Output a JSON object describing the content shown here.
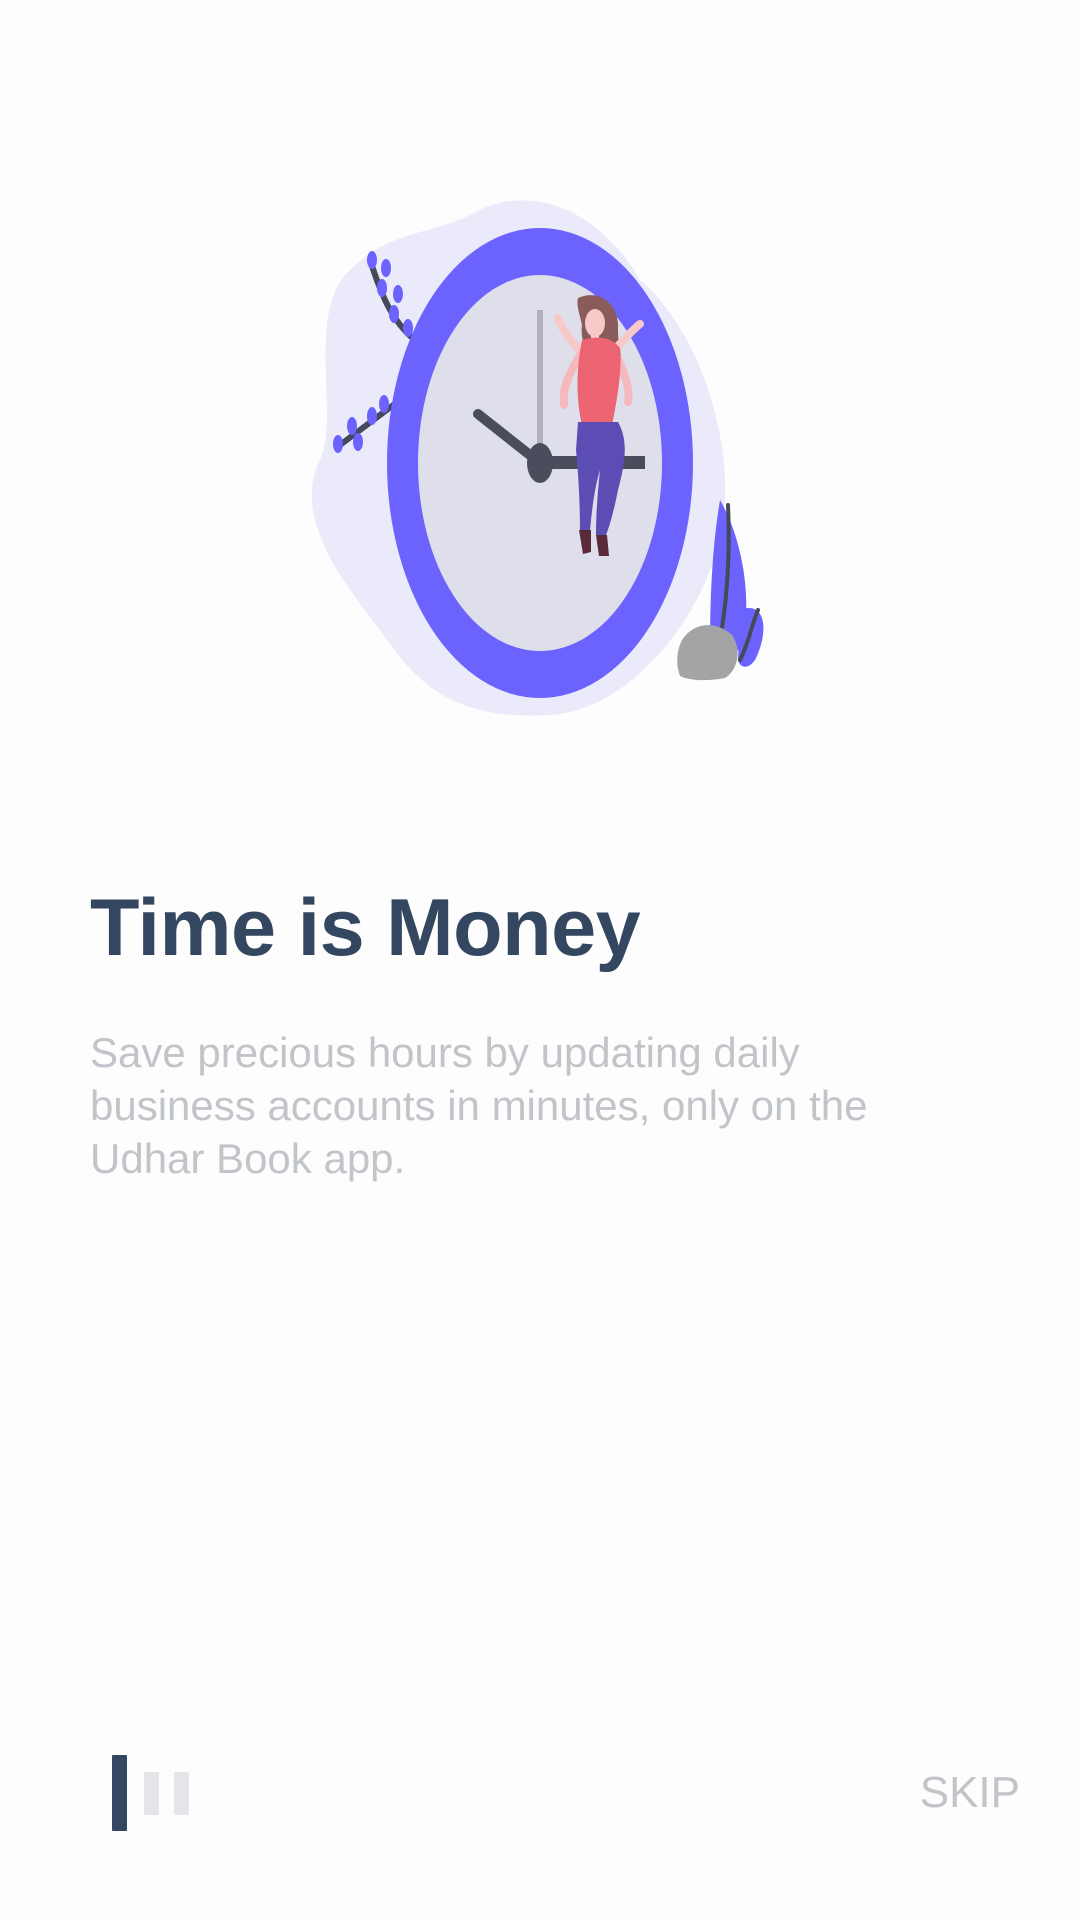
{
  "onboarding": {
    "title": "Time is Money",
    "description": "Save precious hours by updating daily business accounts in minutes, only on the Udhar Book app.",
    "skip_label": "SKIP",
    "page_indicator": {
      "total": 3,
      "active_index": 0,
      "active_color": "#344760",
      "inactive_color": "#e4e5e8"
    },
    "illustration": {
      "icon": "clock-woman-illustration",
      "accent_color": "#6c63ff"
    }
  }
}
